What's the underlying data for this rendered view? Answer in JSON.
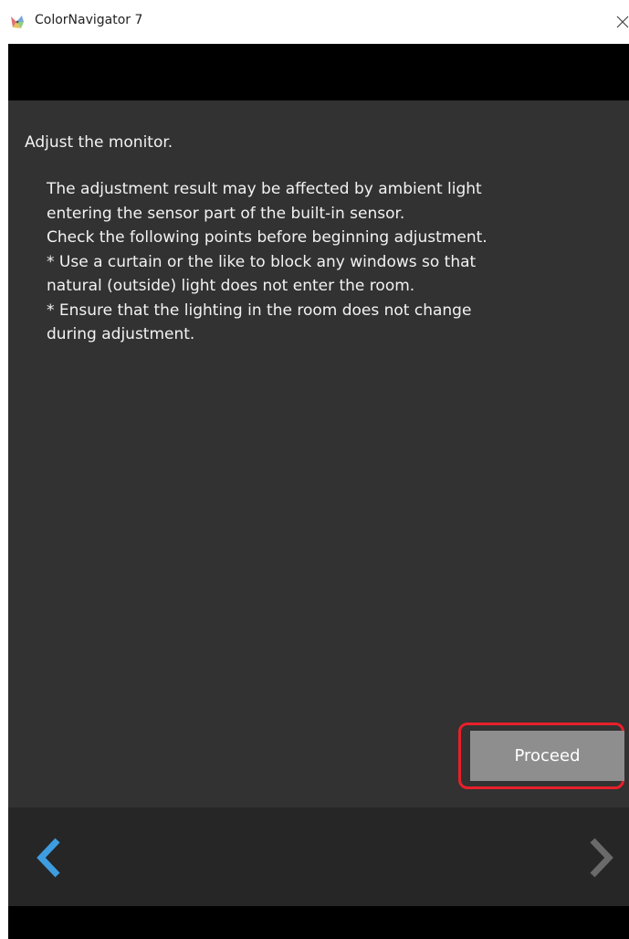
{
  "window": {
    "title": "ColorNavigator 7",
    "app_icon": "colornavigator-app-icon",
    "close_icon": "close-icon"
  },
  "content": {
    "heading": "Adjust the monitor.",
    "lines": [
      "The adjustment result may be affected by ambient light",
      "entering the sensor part of the built-in sensor.",
      "Check the following points before beginning adjustment.",
      "* Use a curtain or the like to block any windows so that",
      "natural (outside) light does not enter the room.",
      "* Ensure that the lighting in the room does not change",
      "during adjustment."
    ]
  },
  "actions": {
    "proceed_label": "Proceed",
    "highlight_color": "#e8202a"
  },
  "nav": {
    "back_icon": "chevron-left-icon",
    "forward_icon": "chevron-right-icon",
    "back_color": "#3d9de0",
    "forward_color": "#6a6a6a"
  },
  "colors": {
    "content_bg": "#323232",
    "nav_bg": "#262626",
    "button_bg": "#8e8e8e"
  }
}
